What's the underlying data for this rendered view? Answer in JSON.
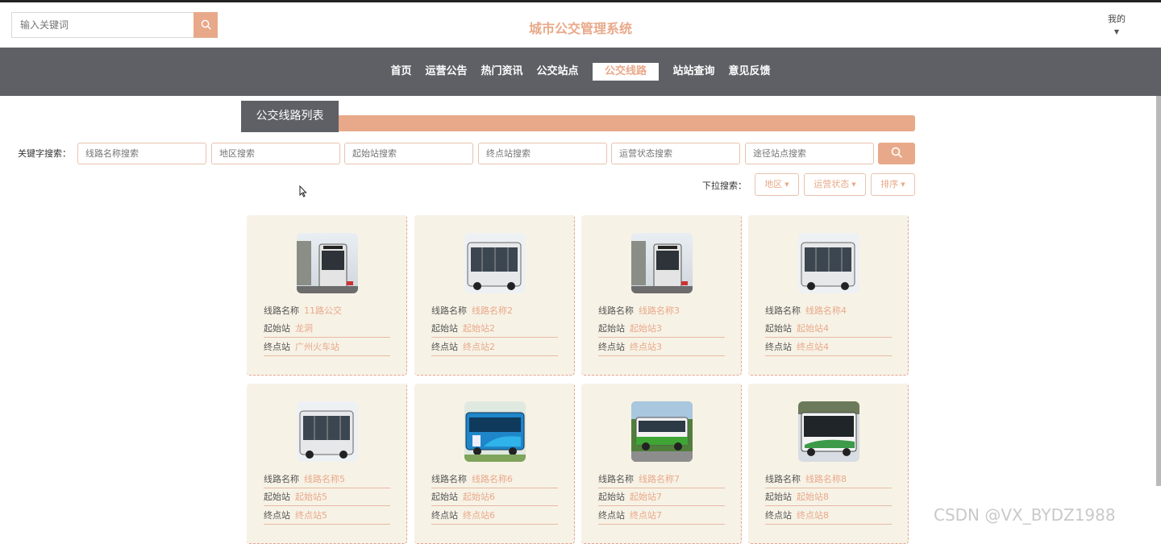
{
  "header": {
    "search_placeholder": "输入关键词",
    "site_title": "城市公交管理系统",
    "user_label": "我的"
  },
  "nav": {
    "items": [
      "首页",
      "运营公告",
      "热门资讯",
      "公交站点",
      "公交线路",
      "站站查询",
      "意见反馈"
    ],
    "active": "公交线路"
  },
  "section_title": "公交线路列表",
  "keyword_search": {
    "label": "关键字搜索：",
    "fields": [
      {
        "placeholder": "线路名称搜索"
      },
      {
        "placeholder": "地区搜索"
      },
      {
        "placeholder": "起始站搜索"
      },
      {
        "placeholder": "终点站搜索"
      },
      {
        "placeholder": "运营状态搜索"
      },
      {
        "placeholder": "途径站点搜索"
      }
    ]
  },
  "dropdown_search": {
    "label": "下拉搜索：",
    "buttons": [
      "地区",
      "运营状态",
      "排序"
    ]
  },
  "cards": [
    {
      "line_label": "线路名称",
      "line_value": "11路公交",
      "start_label": "起始站",
      "start_value": "龙洞",
      "end_label": "终点站",
      "end_value": "广州火车站"
    },
    {
      "line_label": "线路名称",
      "line_value": "线路名称2",
      "start_label": "起始站",
      "start_value": "起始站2",
      "end_label": "终点站",
      "end_value": "终点站2"
    },
    {
      "line_label": "线路名称",
      "line_value": "线路名称3",
      "start_label": "起始站",
      "start_value": "起始站3",
      "end_label": "终点站",
      "end_value": "终点站3"
    },
    {
      "line_label": "线路名称",
      "line_value": "线路名称4",
      "start_label": "起始站",
      "start_value": "起始站4",
      "end_label": "终点站",
      "end_value": "终点站4"
    },
    {
      "line_label": "线路名称",
      "line_value": "线路名称5",
      "start_label": "起始站",
      "start_value": "起始站5",
      "end_label": "终点站",
      "end_value": "终点站5"
    },
    {
      "line_label": "线路名称",
      "line_value": "线路名称6",
      "start_label": "起始站",
      "start_value": "起始站6",
      "end_label": "终点站",
      "end_value": "终点站6"
    },
    {
      "line_label": "线路名称",
      "line_value": "线路名称7",
      "start_label": "起始站",
      "start_value": "起始站7",
      "end_label": "终点站",
      "end_value": "终点站7"
    },
    {
      "line_label": "线路名称",
      "line_value": "线路名称8",
      "start_label": "起始站",
      "start_value": "起始站8",
      "end_label": "终点站",
      "end_value": "终点站8"
    }
  ],
  "watermark": "CSDN @VX_BYDZ1988",
  "colors": {
    "accent": "#e8a98a",
    "nav_bg": "#5f6066",
    "card_bg": "#f7f2e6"
  },
  "icons": {
    "search": "search-icon",
    "caret": "caret-down-icon",
    "cursor": "mouse-cursor-icon"
  }
}
